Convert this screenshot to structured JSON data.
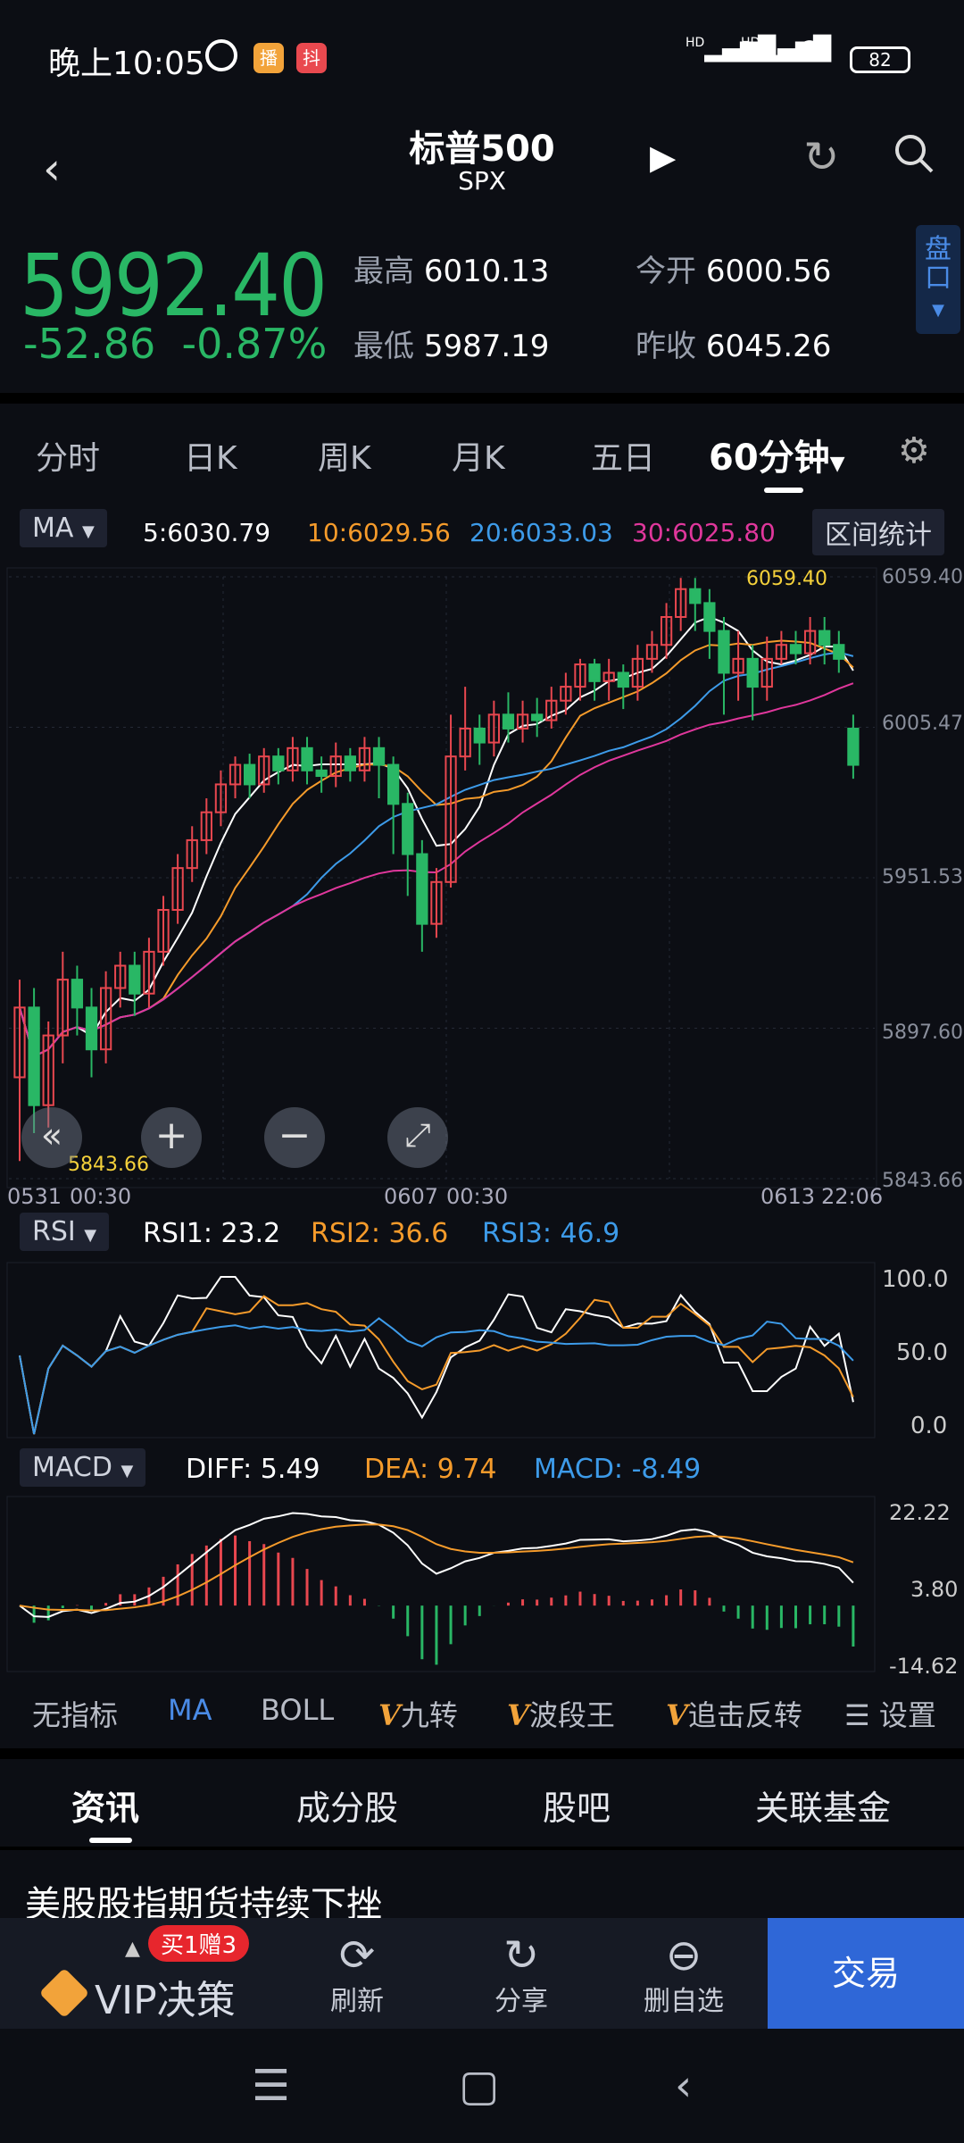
{
  "status_bar": {
    "time": "晚上10:05",
    "app1": "播",
    "app2": "抖",
    "network1": "HD",
    "network2": "HD",
    "battery": "82"
  },
  "header": {
    "title": "标普500",
    "subtitle": "SPX"
  },
  "quote": {
    "price": "5992.40",
    "change": "-52.86",
    "change_pct": "-0.87%",
    "high_label": "最高",
    "high": "6010.13",
    "open_label": "今开",
    "open": "6000.56",
    "low_label": "最低",
    "low": "5987.19",
    "prev_close_label": "昨收",
    "prev_close": "6045.26",
    "pankou": "盘口"
  },
  "period_tabs": [
    "分时",
    "日K",
    "周K",
    "月K",
    "五日",
    "60分钟"
  ],
  "chart_header": {
    "indicator": "MA",
    "ma5": "5:6030.79",
    "ma10": "10:6029.56",
    "ma20": "20:6033.03",
    "ma30": "30:6025.80",
    "range_button": "区间统计"
  },
  "colors": {
    "up": "#e8474f",
    "down": "#29b765",
    "ma5": "#ffffff",
    "ma10": "#f59b2b",
    "ma20": "#3d9be9",
    "ma30": "#e0379c",
    "accent": "#2f67d7"
  },
  "chart_data": [
    {
      "type": "candlestick",
      "y_axis_labels": [
        "6059.40",
        "6005.47",
        "5951.53",
        "5897.60",
        "5843.66"
      ],
      "ylim": [
        5843.66,
        6059.4
      ],
      "x_labels": [
        "0531",
        "00:30",
        "0607",
        "00:30",
        "0613",
        "22:06"
      ],
      "annotations": {
        "max": "6059.40",
        "min": "5843.66"
      },
      "candles": [
        [
          5880,
          5905,
          5850,
          5915
        ],
        [
          5905,
          5870,
          5860,
          5912
        ],
        [
          5870,
          5895,
          5862,
          5900
        ],
        [
          5895,
          5915,
          5885,
          5925
        ],
        [
          5915,
          5905,
          5895,
          5920
        ],
        [
          5905,
          5890,
          5880,
          5912
        ],
        [
          5890,
          5912,
          5885,
          5918
        ],
        [
          5912,
          5920,
          5905,
          5925
        ],
        [
          5920,
          5910,
          5902,
          5925
        ],
        [
          5910,
          5925,
          5905,
          5930
        ],
        [
          5925,
          5940,
          5920,
          5945
        ],
        [
          5940,
          5955,
          5935,
          5960
        ],
        [
          5955,
          5965,
          5950,
          5970
        ],
        [
          5965,
          5975,
          5960,
          5980
        ],
        [
          5975,
          5985,
          5970,
          5990
        ],
        [
          5985,
          5992,
          5980,
          5995
        ],
        [
          5992,
          5985,
          5980,
          5996
        ],
        [
          5985,
          5995,
          5982,
          5998
        ],
        [
          5995,
          5990,
          5985,
          5998
        ],
        [
          5990,
          5998,
          5986,
          6002
        ],
        [
          5998,
          5990,
          5985,
          6002
        ],
        [
          5990,
          5988,
          5982,
          5995
        ],
        [
          5988,
          5995,
          5984,
          6000
        ],
        [
          5995,
          5990,
          5986,
          5998
        ],
        [
          5990,
          5998,
          5986,
          6002
        ],
        [
          5998,
          5992,
          5980,
          6002
        ],
        [
          5992,
          5978,
          5960,
          5995
        ],
        [
          5978,
          5960,
          5945,
          5982
        ],
        [
          5960,
          5935,
          5925,
          5965
        ],
        [
          5935,
          5950,
          5930,
          5955
        ],
        [
          5950,
          5995,
          5948,
          6010
        ],
        [
          5995,
          6005,
          5990,
          6020
        ],
        [
          6005,
          6000,
          5992,
          6010
        ],
        [
          6000,
          6010,
          5995,
          6015
        ],
        [
          6010,
          6005,
          6000,
          6018
        ],
        [
          6005,
          6010,
          6000,
          6015
        ],
        [
          6010,
          6008,
          6002,
          6016
        ],
        [
          6008,
          6015,
          6005,
          6020
        ],
        [
          6015,
          6020,
          6010,
          6025
        ],
        [
          6020,
          6028,
          6015,
          6030
        ],
        [
          6028,
          6022,
          6015,
          6030
        ],
        [
          6022,
          6025,
          6015,
          6030
        ],
        [
          6025,
          6020,
          6012,
          6028
        ],
        [
          6020,
          6030,
          6015,
          6035
        ],
        [
          6030,
          6035,
          6025,
          6040
        ],
        [
          6035,
          6045,
          6030,
          6050
        ],
        [
          6045,
          6055,
          6040,
          6059
        ],
        [
          6055,
          6050,
          6040,
          6059
        ],
        [
          6050,
          6040,
          6030,
          6055
        ],
        [
          6040,
          6025,
          6010,
          6045
        ],
        [
          6025,
          6030,
          6015,
          6040
        ],
        [
          6030,
          6020,
          6008,
          6035
        ],
        [
          6020,
          6030,
          6015,
          6038
        ],
        [
          6030,
          6035,
          6028,
          6040
        ],
        [
          6035,
          6032,
          6028,
          6040
        ],
        [
          6032,
          6040,
          6028,
          6045
        ],
        [
          6040,
          6035,
          6028,
          6045
        ],
        [
          6035,
          6030,
          6025,
          6040
        ],
        [
          6005,
          5992,
          5987,
          6010
        ]
      ]
    },
    {
      "type": "line",
      "title": "RSI",
      "series": [
        {
          "name": "RSI1",
          "latest": "23.2"
        },
        {
          "name": "RSI2",
          "latest": "36.6"
        },
        {
          "name": "RSI3",
          "latest": "46.9"
        }
      ],
      "y_axis_labels": [
        "100.0",
        "50.0",
        "0.0"
      ],
      "ylim": [
        0,
        100
      ]
    },
    {
      "type": "bar",
      "title": "MACD",
      "series": [
        {
          "name": "DIFF",
          "latest": "5.49"
        },
        {
          "name": "DEA",
          "latest": "9.74"
        },
        {
          "name": "MACD",
          "latest": "-8.49"
        }
      ],
      "y_axis_labels": [
        "22.22",
        "3.80",
        "-14.62"
      ],
      "ylim": [
        -14.62,
        22.22
      ]
    }
  ],
  "rsi": {
    "indicator": "RSI",
    "rsi1": "RSI1:  23.2",
    "rsi2": "RSI2:  36.6",
    "rsi3": "RSI3:  46.9"
  },
  "macd": {
    "indicator": "MACD",
    "diff": "DIFF:  5.49",
    "dea": "DEA:  9.74",
    "macd": "MACD:  -8.49"
  },
  "indicator_tabs": {
    "none": "无指标",
    "ma": "MA",
    "boll": "BOLL",
    "jiuzhuan": "九转",
    "boduanwang": "波段王",
    "zhuiji": "追击反转",
    "settings": "设置"
  },
  "news_tabs": [
    "资讯",
    "成分股",
    "股吧",
    "关联基金"
  ],
  "headline": "美股股指期货持续下挫",
  "action_bar": {
    "vip": "VIP决策",
    "promo": "买1赠3",
    "refresh": "刷新",
    "share": "分享",
    "remove": "删自选",
    "trade": "交易"
  }
}
